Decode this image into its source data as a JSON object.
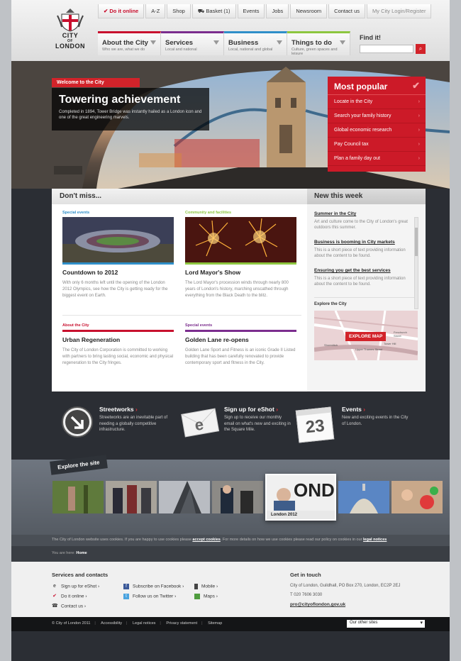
{
  "logo": {
    "line1": "CITY",
    "line2": "LONDON",
    "of": "OF"
  },
  "utility": [
    {
      "label": "✔ Do it online",
      "style": "red"
    },
    {
      "label": "A-Z",
      "style": ""
    },
    {
      "label": "Shop",
      "style": ""
    },
    {
      "label": "⛟ Basket (1)",
      "style": ""
    },
    {
      "label": "Events",
      "style": ""
    },
    {
      "label": "Jobs",
      "style": ""
    },
    {
      "label": "Newsroom",
      "style": ""
    },
    {
      "label": "Contact us",
      "style": ""
    },
    {
      "label": "My City Login/Register",
      "style": "grey"
    }
  ],
  "nav": [
    {
      "title": "About the City",
      "sub": "Who we are, what we do",
      "color": "#c8102e"
    },
    {
      "title": "Services",
      "sub": "Local and national",
      "color": "#7b2d8e"
    },
    {
      "title": "Business",
      "sub": "Local, national and global",
      "color": "#2f8fc9"
    },
    {
      "title": "Things to do",
      "sub": "Culture, green spaces and leisure",
      "color": "#8dc63f"
    }
  ],
  "find": {
    "label": "Find it!",
    "placeholder": ""
  },
  "hero": {
    "tag": "Welcome to the City",
    "title": "Towering achievement",
    "text": "Completed in 1894, Tower Bridge was instantly hailed as a London icon and one of the great engineering marvels."
  },
  "popular": {
    "title": "Most popular",
    "items": [
      "Locate in the City",
      "Search your family history",
      "Global economic research",
      "Pay Council tax",
      "Plan a family day out"
    ]
  },
  "dontmiss": {
    "title": "Don't miss...",
    "cards": [
      {
        "cat": "Special events",
        "cat_color": "#2f8fc9",
        "title": "Countdown to 2012",
        "text": "With only 6 months left until the opening of the London 2012 Olympics, see how the City is getting ready for the biggest event on Earth."
      },
      {
        "cat": "Community and facilities",
        "cat_color": "#8dc63f",
        "title": "Lord Mayor's Show",
        "text": "The Lord Mayor's procession winds through nearly 800 years of London's history, marching unscathed through everything from the Black Death to the blitz."
      },
      {
        "cat": "About the City",
        "cat_color": "#c8102e",
        "title": "Urban Regeneration",
        "text": "The City of London Corporation is committed to working with partners to bring lasting social, economic and physical regeneration to the City fringes."
      },
      {
        "cat": "Special events",
        "cat_color": "#7b2d8e",
        "title": "Golden Lane re-opens",
        "text": "Golden Lane Sport and Fitness is an iconic Grade II Listed building that has been carefully renovated to provide contemporary sport and fitness in the City."
      }
    ]
  },
  "newthisweek": {
    "title": "New this week",
    "items": [
      {
        "title": "Summer in the City",
        "text": "Art and culture come to the City of London's great outdoors this summer."
      },
      {
        "title": "Business is booming in City markets",
        "text": "This is a short piece of text providing information about the content to be found."
      },
      {
        "title": "Ensuring you get the best services",
        "text": "This is a short piece of text providing information about the content to be found."
      }
    ],
    "explore_label": "Explore the City",
    "map_button": "EXPLORE MAP",
    "map_places": [
      "Fenchurch Street",
      "Tower Hill",
      "Shoreditch",
      "Upper Thames Street"
    ]
  },
  "services": [
    {
      "title": "Streetworks",
      "text": "Streetworks are an inevitable part of needing a globally competitive infrastructure."
    },
    {
      "title": "Sign up for eShot",
      "text": "Sign up to receive our monthly email on what's new and exciting in the Square Mile."
    },
    {
      "title": "Events",
      "text": "New and exciting events in the City of London.",
      "date": "23"
    }
  ],
  "explore": {
    "tag": "Explore the site",
    "caption": "London 2012"
  },
  "cookie": {
    "pre": "The City of London website uses cookies. If you are happy to use cookies please ",
    "link1": "accept cookies",
    "mid": ". For more details on how we use cookies please read our policy on cookies in our ",
    "link2": "legal notices"
  },
  "breadcrumb": {
    "label": "You are here:",
    "home": "Home"
  },
  "footer": {
    "services_title": "Services and contacts",
    "links": [
      {
        "label": "Sign up for eShot ›",
        "icon": "e"
      },
      {
        "label": "Subscribe on Facebook ›",
        "icon": "f"
      },
      {
        "label": "Mobile ›",
        "icon": "m"
      },
      {
        "label": "Do it online ›",
        "icon": "✔"
      },
      {
        "label": "Follow us on Twitter ›",
        "icon": "t"
      },
      {
        "label": "Maps ›",
        "icon": "▦"
      },
      {
        "label": "Contact us ›",
        "icon": "☎"
      }
    ],
    "touch_title": "Get in touch",
    "address": "City of London, Guildhall, PO Box 270, London, EC2P 2EJ",
    "phone": "T 020 7606 3030",
    "email": "pro@cityoflondon.gov.uk"
  },
  "legal": {
    "items": [
      "© City of London 2011",
      "Accessibility",
      "Legal notices",
      "Privacy statement",
      "Sitemap"
    ],
    "select": "Our other sites"
  }
}
